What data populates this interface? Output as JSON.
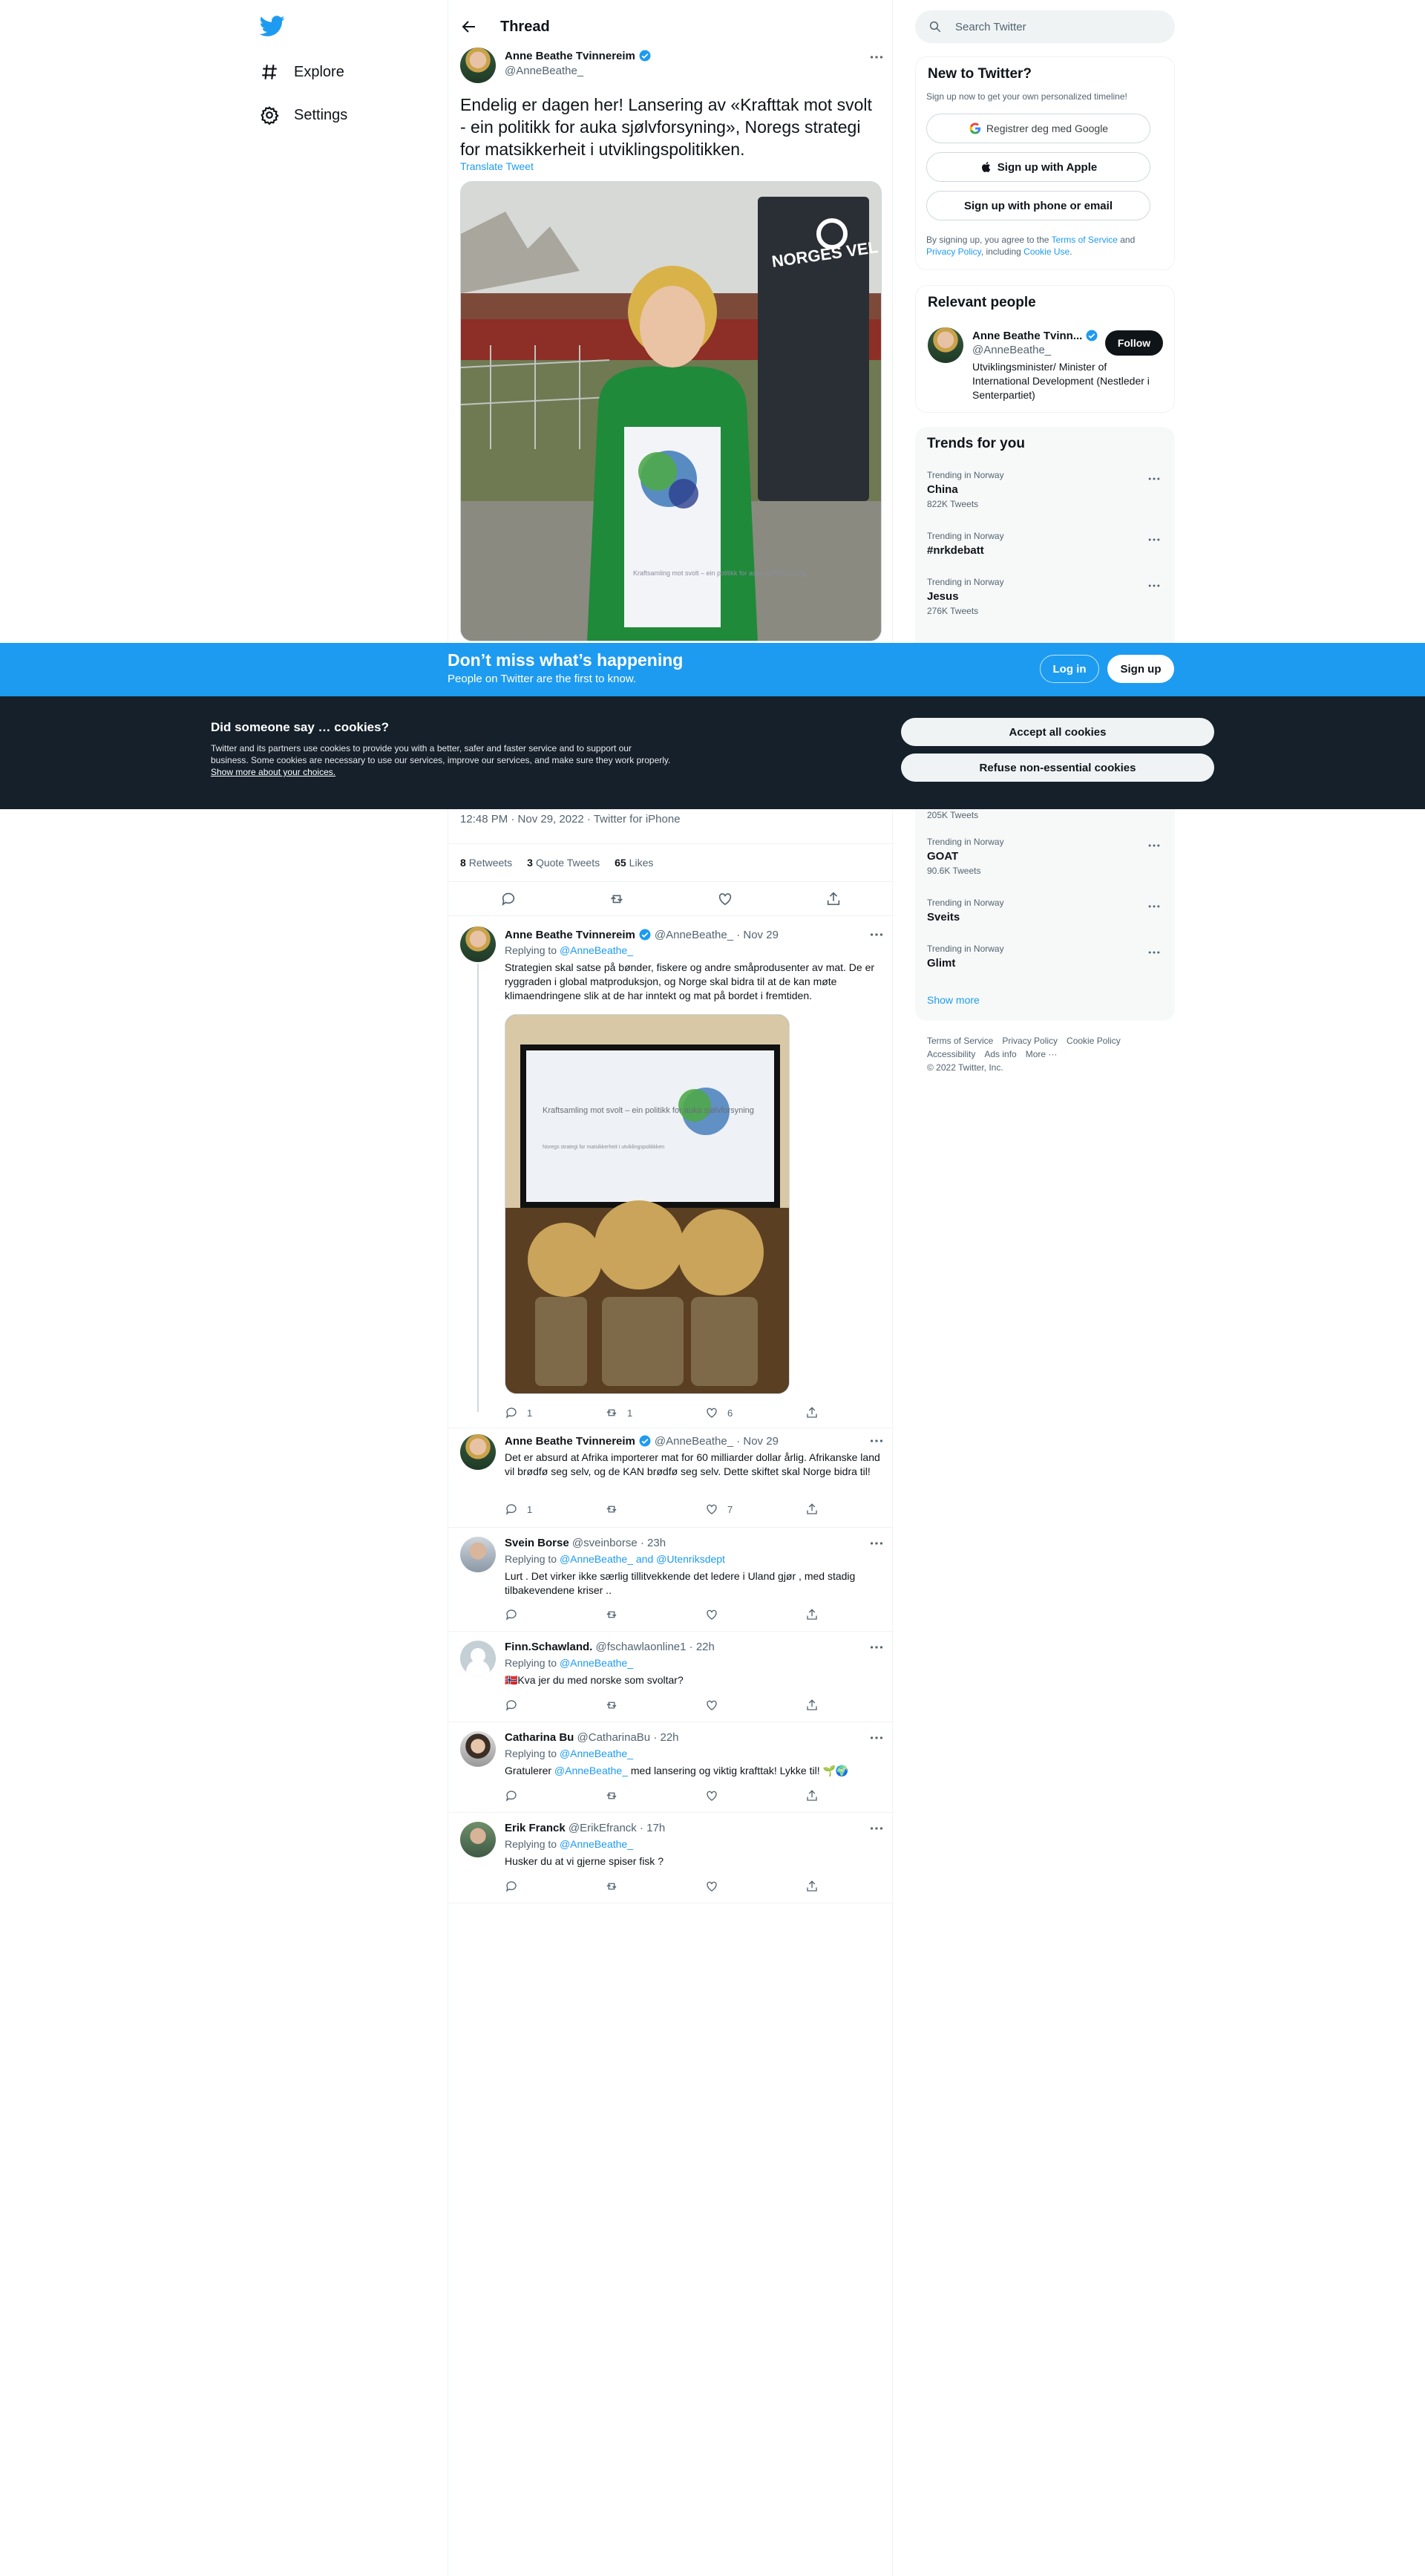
{
  "nav": {
    "explore_label": "Explore",
    "settings_label": "Settings"
  },
  "header": {
    "title": "Thread"
  },
  "main_tweet": {
    "author_name": "Anne Beathe Tvinnereim",
    "handle": "@AnneBeathe_",
    "text": "Endelig er dagen her! Lansering av «Krafttak mot svolt - ein politikk for auka sjølvforsyning», Noregs strategi for matsikkerheit i utviklingspolitikken.",
    "translate_label": "Translate Tweet",
    "image_sign_text": "NORGES VEL",
    "image_doc_text": "Kraftsamling mot svolt – ein politikk for auka sjølvforsyning",
    "timestamp": "12:48 PM · Nov 29, 2022 · Twitter for iPhone",
    "retweets_count": "8",
    "retweets_label": "Retweets",
    "quotes_count": "3",
    "quotes_label": "Quote Tweets",
    "likes_count": "65",
    "likes_label": "Likes"
  },
  "replies": [
    {
      "name": "Anne Beathe Tvinnereim",
      "handle": "@AnneBeathe_",
      "time": "· Nov 29",
      "replying_prefix": "Replying to",
      "replying_to": "@AnneBeathe_",
      "text": "Strategien skal satse på bønder, fiskere og andre småprodusenter av mat. De er ryggraden i global matproduksjon, og Norge skal bidra til at de kan møte klimaendringene slik at de har inntekt og mat på bordet i fremtiden.",
      "image_text_title": "Kraftsamling mot svolt – ein politikk for auka sjølvforsyning",
      "image_text_sub": "Noregs strategi for matsikkerheit i utviklingspolitikken",
      "replies": "1",
      "retweets": "1",
      "likes": "6"
    },
    {
      "name": "Anne Beathe Tvinnereim",
      "handle": "@AnneBeathe_",
      "time": "· Nov 29",
      "text": "Det er absurd at Afrika importerer mat for 60 milliarder dollar årlig. Afrikanske land vil brødfø seg selv, og de KAN brødfø seg selv. Dette skiftet skal Norge bidra til!",
      "replies": "1",
      "retweets": "",
      "likes": "7"
    },
    {
      "name": "Svein Borse",
      "handle": "@sveinborse",
      "time": "· 23h",
      "replying_prefix": "Replying to",
      "replying_to": "@AnneBeathe_ and @Utenriksdept",
      "text": "Lurt . Det virker ikke særlig tillitvekkende det ledere i Uland gjør , med stadig tilbakevendene kriser ..",
      "replies": "",
      "retweets": "",
      "likes": ""
    },
    {
      "name": "Finn.Schawland.",
      "handle": "@fschawlaonline1",
      "time": "· 22h",
      "replying_prefix": "Replying to",
      "replying_to": "@AnneBeathe_",
      "text": "🇳🇴Kva jer du med norske som svoltar?",
      "replies": "",
      "retweets": "",
      "likes": ""
    },
    {
      "name": "Catharina Bu",
      "handle": "@CatharinaBu",
      "time": "· 22h",
      "replying_prefix": "Replying to",
      "replying_to": "@AnneBeathe_",
      "text_before": "Gratulerer ",
      "text_mention": "@AnneBeathe_",
      "text_after": " med lansering og viktig krafttak! Lykke til! 🌱🌍",
      "replies": "",
      "retweets": "",
      "likes": ""
    },
    {
      "name": "Erik Franck",
      "handle": "@ErikEfranck",
      "time": "· 17h",
      "replying_prefix": "Replying to",
      "replying_to": "@AnneBeathe_",
      "text": "Husker du at vi gjerne spiser fisk ?",
      "replies": "",
      "retweets": "",
      "likes": ""
    }
  ],
  "sidebar": {
    "search_placeholder": "Search Twitter",
    "new_to_twitter": {
      "title": "New to Twitter?",
      "subtitle": "Sign up now to get your own personalized timeline!",
      "google_label": "Registrer deg med Google",
      "apple_label": "Sign up with Apple",
      "phone_label": "Sign up with phone or email",
      "legal_1": "By signing up, you agree to the ",
      "terms": "Terms of Service",
      "legal_2": " and ",
      "privacy": "Privacy Policy",
      "legal_3": ", including ",
      "cookie": "Cookie Use",
      "legal_4": "."
    },
    "relevant": {
      "title": "Relevant people",
      "name": "Anne Beathe Tvinn...",
      "handle": "@AnneBeathe_",
      "bio": "Utviklingsminister/ Minister of International Development (Nestleder i Senterpartiet)",
      "follow_label": "Follow"
    },
    "trends": {
      "title": "Trends for you",
      "items": [
        {
          "context": "Trending in Norway",
          "name": "China",
          "count": "822K Tweets"
        },
        {
          "context": "Trending in Norway",
          "name": "#nrkdebatt",
          "count": ""
        },
        {
          "context": "Trending in Norway",
          "name": "Jesus",
          "count": "276K Tweets"
        },
        {
          "context": "",
          "name": "",
          "count": "205K Tweets"
        },
        {
          "context": "Trending in Norway",
          "name": "GOAT",
          "count": "90.6K Tweets"
        },
        {
          "context": "Trending in Norway",
          "name": "Sveits",
          "count": ""
        },
        {
          "context": "Trending in Norway",
          "name": "Glimt",
          "count": ""
        }
      ],
      "show_more": "Show more"
    },
    "footer": {
      "terms": "Terms of Service",
      "privacy": "Privacy Policy",
      "cookie": "Cookie Policy",
      "accessibility": "Accessibility",
      "ads": "Ads info",
      "more": "More ···",
      "copyright": "© 2022 Twitter, Inc."
    }
  },
  "dont_miss": {
    "title": "Don’t miss what’s happening",
    "subtitle": "People on Twitter are the first to know.",
    "login_label": "Log in",
    "signup_label": "Sign up"
  },
  "cookies": {
    "title": "Did someone say … cookies?",
    "body": "Twitter and its partners use cookies to provide you with a better, safer and faster service and to support our business. Some cookies are necessary to use our services, improve our services, and make sure they work properly. ",
    "link": "Show more about your choices.",
    "accept_label": "Accept all cookies",
    "refuse_label": "Refuse non-essential cookies"
  },
  "colors": {
    "accent": "#1d9bf0",
    "cookie_bg": "#15202b",
    "text": "#0f1419",
    "secondary": "#536471"
  }
}
